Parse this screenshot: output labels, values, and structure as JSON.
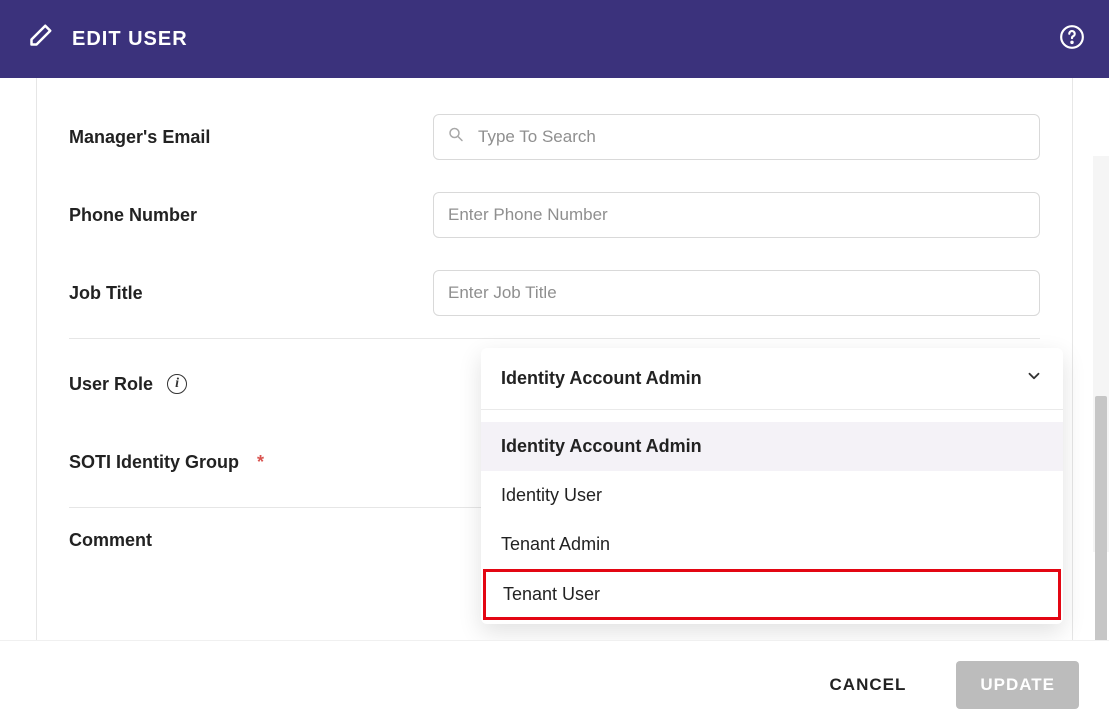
{
  "header": {
    "title": "EDIT USER"
  },
  "form": {
    "managerEmail": {
      "label": "Manager's Email",
      "placeholder": "Type To Search",
      "value": ""
    },
    "phone": {
      "label": "Phone Number",
      "placeholder": "Enter Phone Number",
      "value": ""
    },
    "jobTitle": {
      "label": "Job Title",
      "placeholder": "Enter Job Title",
      "value": ""
    },
    "userRole": {
      "label": "User Role",
      "selected": "Identity Account Admin",
      "options": [
        "Identity Account Admin",
        "Identity User",
        "Tenant Admin",
        "Tenant User"
      ]
    },
    "sotiGroup": {
      "label": "SOTI Identity Group"
    },
    "comment": {
      "label": "Comment"
    }
  },
  "footer": {
    "cancel": "CANCEL",
    "update": "UPDATE"
  }
}
